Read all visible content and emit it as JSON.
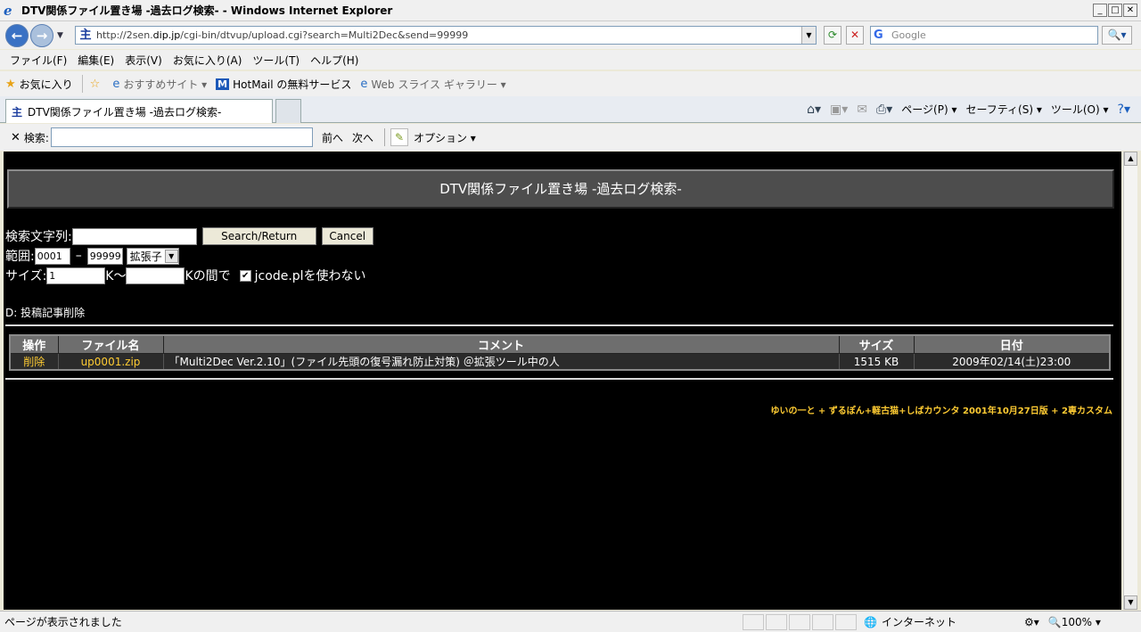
{
  "window": {
    "title": "DTV関係ファイル置き場 -過去ログ検索- - Windows Internet Explorer"
  },
  "address": {
    "url_prefix": "http://2sen.",
    "url_domain": "dip.jp",
    "url_path": "/cgi-bin/dtvup/upload.cgi?search=Multi2Dec&send=99999",
    "search_placeholder": "Google"
  },
  "menu": [
    "ファイル(F)",
    "編集(E)",
    "表示(V)",
    "お気に入り(A)",
    "ツール(T)",
    "ヘルプ(H)"
  ],
  "favorites": {
    "label": "お気に入り",
    "items": [
      "おすすめサイト ▾",
      "HotMail の無料サービス",
      "Web スライス ギャラリー ▾"
    ]
  },
  "tab": {
    "label": "DTV関係ファイル置き場 -過去ログ検索-"
  },
  "commands": [
    "ページ(P) ▾",
    "セーフティ(S) ▾",
    "ツール(O) ▾"
  ],
  "findbar": {
    "label": "検索:",
    "prev": "前へ",
    "next": "次へ",
    "options": "オプション ▾"
  },
  "page": {
    "banner": "DTV関係ファイル置き場 -過去ログ検索-",
    "search_label": "検索文字列:",
    "search_value": "",
    "search_button": "Search/Return",
    "cancel_button": "Cancel",
    "range_label": "範囲:",
    "range_from": "0001",
    "range_sep": "–",
    "range_to": "99999",
    "ext_select": "拡張子",
    "size_label": "サイズ:",
    "size_from": "1",
    "size_mid": "K～",
    "size_to": "",
    "size_end": "Kの間で",
    "jcode_label": "jcode.plを使わない",
    "jcode_checked": true,
    "delete_note": "D: 投稿記事削除",
    "columns": [
      "操作",
      "ファイル名",
      "コメント",
      "サイズ",
      "日付"
    ],
    "rows": [
      {
        "op": "削除",
        "file": "up0001.zip",
        "comment": "「Multi2Dec Ver.2.10」(ファイル先頭の復号漏れ防止対策) ＠拡張ツール中の人",
        "size": "1515 KB",
        "date": "2009年02/14(土)23:00"
      }
    ],
    "credit": "ゆいの一と + ずるぽん+軽古猫+しばカウンタ 2001年10月27日版 + 2専カスタム"
  },
  "status": {
    "message": "ページが表示されました",
    "zone": "インターネット",
    "zoom": "100%"
  },
  "colors": {
    "page_bg": "#000000",
    "link_yellow": "#ffcc33",
    "header_gray": "#6e6e6e"
  }
}
